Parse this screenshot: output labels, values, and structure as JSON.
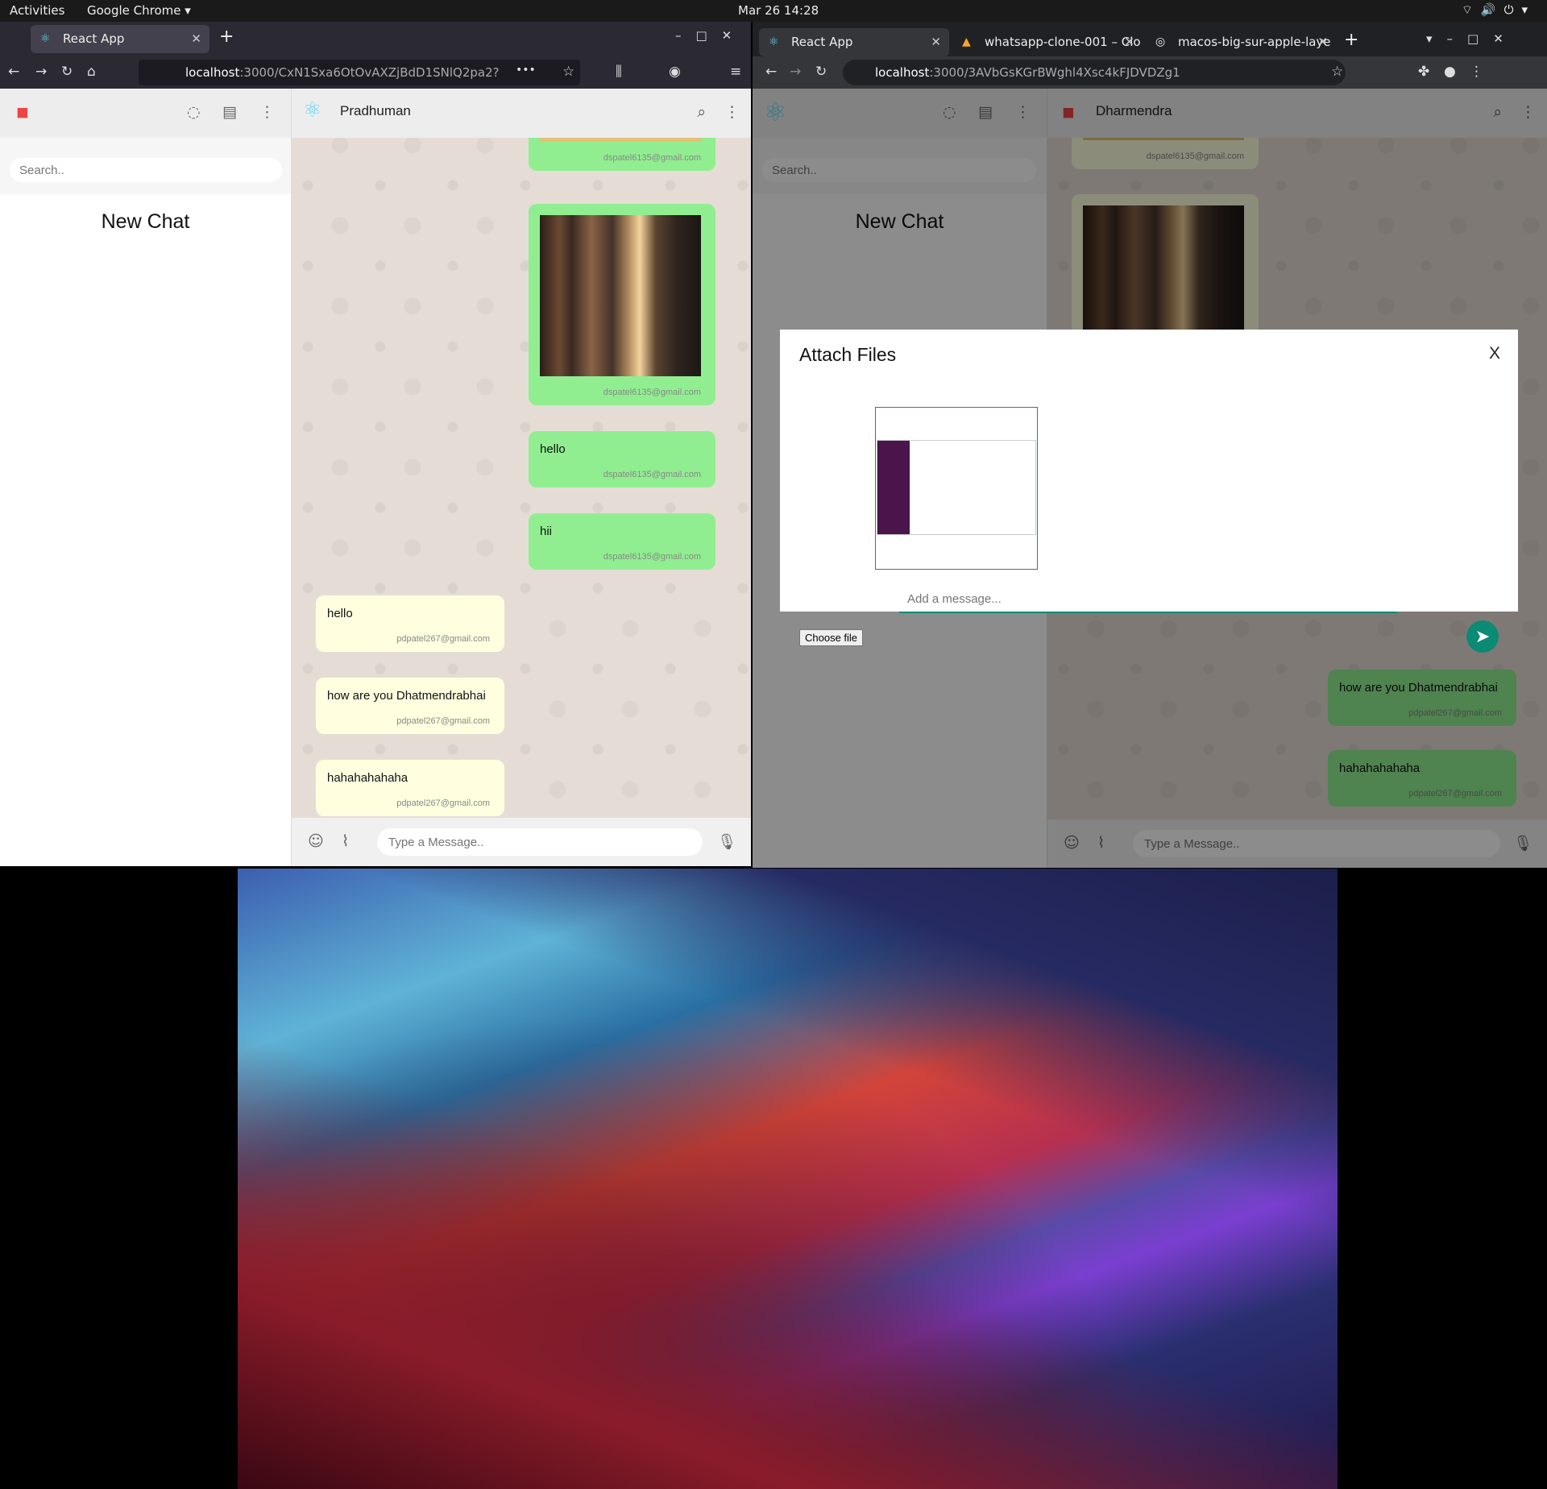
{
  "topbar": {
    "activities": "Activities",
    "app": "Google Chrome ▾",
    "clock": "Mar 26  14:28"
  },
  "firefox": {
    "tab_title": "React App",
    "url_host": "localhost",
    "url_path": ":3000/CxN1Sxa6OtOvAXZjBdD1SNlQ2pa2?",
    "search_placeholder": "Search..",
    "new_chat": "New Chat",
    "contact_name": "Pradhuman",
    "messages": [
      {
        "text": "",
        "email": "dspatel6135@gmail.com"
      },
      {
        "text": "",
        "email": "dspatel6135@gmail.com"
      },
      {
        "text": "hello",
        "email": "dspatel6135@gmail.com"
      },
      {
        "text": "hii",
        "email": "dspatel6135@gmail.com"
      },
      {
        "text": "hello",
        "email": "pdpatel267@gmail.com"
      },
      {
        "text": "how are you Dhatmendrabhai",
        "email": "pdpatel267@gmail.com"
      },
      {
        "text": "hahahahahaha",
        "email": "pdpatel267@gmail.com"
      }
    ],
    "input_placeholder": "Type a Message.."
  },
  "chrome": {
    "tabs": [
      "React App",
      "whatsapp-clone-001 – Clo",
      "macos-big-sur-apple-laye"
    ],
    "url_host": "localhost",
    "url_path": ":3000/3AVbGsKGrBWghl4Xsc4kFJDVDZg1",
    "search_placeholder": "Search..",
    "new_chat": "New Chat",
    "contact_name": "Dharmendra",
    "messages": [
      {
        "text": "",
        "email": "dspatel6135@gmail.com"
      },
      {
        "text": "how are you Dhatmendrabhai",
        "email": "pdpatel267@gmail.com"
      },
      {
        "text": "hahahahahaha",
        "email": "pdpatel267@gmail.com"
      }
    ],
    "input_placeholder": "Type a Message..",
    "modal": {
      "title": "Attach Files",
      "close": "X",
      "message_placeholder": "Add a message...",
      "choose_file": "Choose file"
    }
  },
  "colors": {
    "outgoing": "#90ee90",
    "incoming": "#ffffe0",
    "accent": "#0b8a74"
  }
}
